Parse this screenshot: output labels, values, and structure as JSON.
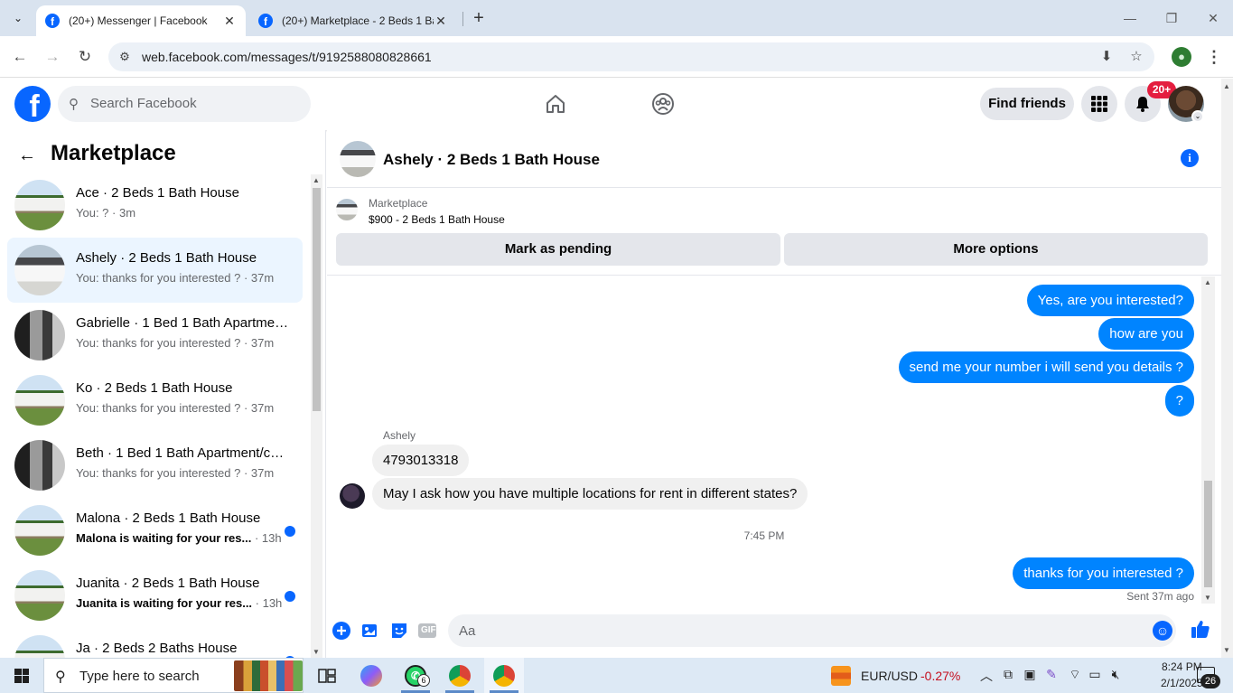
{
  "browser": {
    "tabs": [
      {
        "title": "(20+) Messenger | Facebook",
        "active": true
      },
      {
        "title": "(20+) Marketplace - 2 Beds 1 Bath House",
        "active": false
      }
    ],
    "url": "web.facebook.com/messages/t/9192588080828661",
    "new_tab_glyph": "+",
    "close_glyph": "✕"
  },
  "facebook": {
    "search_placeholder": "Search Facebook",
    "find_friends_label": "Find friends",
    "notification_badge": "20+",
    "accent_color": "#0866ff"
  },
  "sidebar": {
    "title": "Marketplace",
    "conversations": [
      {
        "title": "Ace · 2 Beds 1 Bath House",
        "preview": "You: ?",
        "time": " · 3m",
        "thumb": "house",
        "unread": false,
        "selected": false
      },
      {
        "title": "Ashely · 2 Beds 1 Bath House",
        "preview": "You: thanks for you interested ?",
        "time": " · 37m",
        "thumb": "house2",
        "unread": false,
        "selected": true
      },
      {
        "title": "Gabrielle · 1 Bed 1 Bath Apartment/condo",
        "preview": "You: thanks for you interested ?",
        "time": " · 37m",
        "thumb": "kitchen",
        "unread": false,
        "selected": false
      },
      {
        "title": "Ko · 2 Beds 1 Bath House",
        "preview": "You: thanks for you interested ?",
        "time": " · 37m",
        "thumb": "house",
        "unread": false,
        "selected": false
      },
      {
        "title": "Beth · 1 Bed 1 Bath Apartment/condo",
        "preview": "You: thanks for you interested ?",
        "time": " · 37m",
        "thumb": "kitchen",
        "unread": false,
        "selected": false
      },
      {
        "title": "Malona · 2 Beds 1 Bath House",
        "preview": "Malona is waiting for your res...",
        "time": " · 13h",
        "thumb": "house",
        "unread": true,
        "selected": false
      },
      {
        "title": "Juanita · 2 Beds 1 Bath House",
        "preview": "Juanita is waiting for your res...",
        "time": " · 13h",
        "thumb": "house",
        "unread": true,
        "selected": false
      },
      {
        "title": "Ja · 2 Beds 2 Baths House",
        "preview": "",
        "time": "",
        "thumb": "house",
        "unread": true,
        "selected": false
      }
    ]
  },
  "chat": {
    "title": "Ashely · 2 Beds 1 Bath House",
    "listing": {
      "label": "Marketplace",
      "price_title": "$900 - 2 Beds 1 Bath House",
      "mark_pending_label": "Mark as pending",
      "more_options_label": "More options"
    },
    "messages_out_top": [
      "Yes, are you interested?",
      "how are you",
      "send me your number i will send you details ?",
      "?"
    ],
    "sender_name": "Ashely",
    "messages_in": [
      "4793013318",
      "May I ask how you have multiple locations for rent in different states?"
    ],
    "timestamp": "7:45 PM",
    "messages_out_bottom": [
      "thanks for you interested ?"
    ],
    "sent_status": "Sent 37m ago",
    "composer_placeholder": "Aa",
    "gif_label": "GIF"
  },
  "taskbar": {
    "search_placeholder": "Type here to search",
    "whatsapp_count": "6",
    "ticker_name": "EUR/USD",
    "ticker_value": "-0.27%",
    "clock_time": "8:24 PM",
    "clock_date": "2/1/2025",
    "notification_count": "26"
  }
}
